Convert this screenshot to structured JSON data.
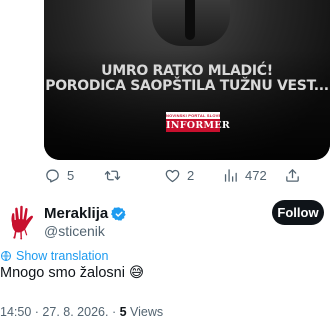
{
  "media": {
    "headline_line1": "UMRO RATKO MLADIĆ!",
    "headline_line2": "PORODICA SAOPŠTILA TUŽNU VEST...",
    "brand_small": "NOVINSKI PORTAL SLOVENIJA",
    "brand_name": "INFORMER"
  },
  "actions": {
    "replies": "5",
    "retweets": "",
    "likes": "2",
    "views": "472"
  },
  "author": {
    "name": "Meraklija",
    "handle": "@sticenik",
    "follow_label": "Follow",
    "avatar_color": "#c8102e"
  },
  "tweet": {
    "translate_label": "Show translation",
    "text": "Mnogo smo žalosni 😅"
  },
  "meta": {
    "time": "14:50",
    "date": "27. 8. 2026.",
    "separator": "·",
    "views_count": "5",
    "views_label": "Views"
  },
  "colors": {
    "accent": "#1d9bf0",
    "text_secondary": "#536471",
    "text_primary": "#0f1419"
  }
}
